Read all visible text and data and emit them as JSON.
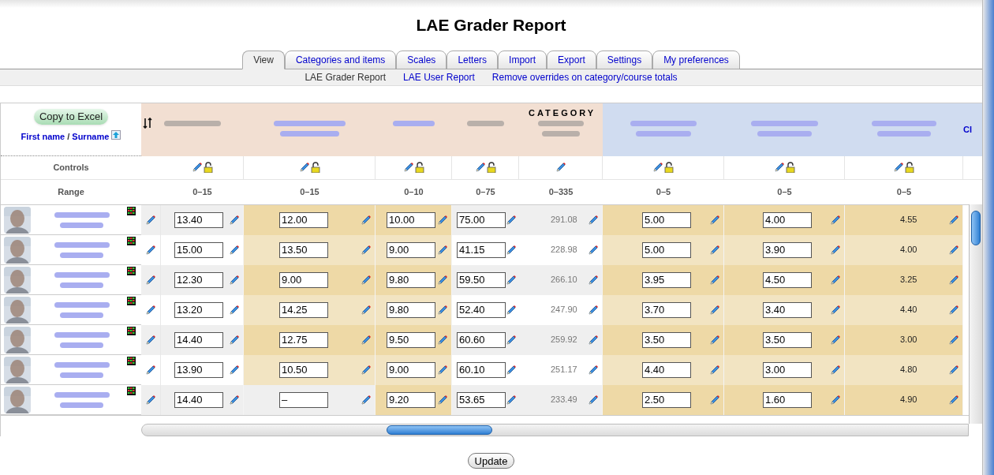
{
  "title": "LAE Grader Report",
  "tabs": [
    {
      "label": "View",
      "selected": true
    },
    {
      "label": "Categories and items",
      "selected": false
    },
    {
      "label": "Scales",
      "selected": false
    },
    {
      "label": "Letters",
      "selected": false
    },
    {
      "label": "Import",
      "selected": false
    },
    {
      "label": "Export",
      "selected": false
    },
    {
      "label": "Settings",
      "selected": false
    },
    {
      "label": "My preferences",
      "selected": false
    }
  ],
  "subnav": [
    {
      "label": "LAE Grader Report",
      "selected": true
    },
    {
      "label": "LAE User Report",
      "selected": false
    },
    {
      "label": "Remove overrides on category/course totals",
      "selected": false
    }
  ],
  "grader": {
    "copy_button": "Copy to Excel",
    "sort_links": [
      "First name",
      "Surname"
    ],
    "sort_separator": "/",
    "controls_label": "Controls",
    "range_label": "Range",
    "partial_header": "Cl",
    "columns": [
      {
        "link": false,
        "color": "#f2dfd2",
        "kind": "input",
        "lock": true,
        "range": "0–15"
      },
      {
        "link": true,
        "color": "#f2dfd2",
        "kind": "input",
        "lock": true,
        "range": "0–15"
      },
      {
        "link": true,
        "color": "#f2dfd2",
        "kind": "input",
        "lock": true,
        "range": "0–10"
      },
      {
        "link": false,
        "color": "#f2dfd2",
        "kind": "input",
        "lock": true,
        "range": "0–75"
      },
      {
        "link": false,
        "color": "#f2dfd2",
        "kind": "total",
        "lock": false,
        "range": "0–335",
        "category_label": "CATEGORY"
      },
      {
        "link": true,
        "color": "#d0dcf0",
        "kind": "input",
        "lock": true,
        "range": "0–5"
      },
      {
        "link": true,
        "color": "#d0dcf0",
        "kind": "input",
        "lock": true,
        "range": "0–5"
      },
      {
        "link": true,
        "color": "#d0dcf0",
        "kind": "total",
        "lock": true,
        "range": "0–5"
      }
    ],
    "rows": [
      {
        "cells": [
          {
            "value": "13.40",
            "highlighted": false
          },
          {
            "value": "12.00",
            "highlighted": true
          },
          {
            "value": "10.00",
            "highlighted": true
          },
          {
            "value": "75.00",
            "highlighted": false
          },
          {
            "value": "291.08",
            "highlighted": false
          },
          {
            "value": "5.00",
            "highlighted": true
          },
          {
            "value": "4.00",
            "highlighted": true
          },
          {
            "value": "4.55",
            "highlighted": true
          }
        ]
      },
      {
        "cells": [
          {
            "value": "15.00",
            "highlighted": false
          },
          {
            "value": "13.50",
            "highlighted": true
          },
          {
            "value": "9.00",
            "highlighted": true
          },
          {
            "value": "41.15",
            "highlighted": false
          },
          {
            "value": "228.98",
            "highlighted": false
          },
          {
            "value": "5.00",
            "highlighted": true
          },
          {
            "value": "3.90",
            "highlighted": true
          },
          {
            "value": "4.00",
            "highlighted": true
          }
        ]
      },
      {
        "cells": [
          {
            "value": "12.30",
            "highlighted": false
          },
          {
            "value": "9.00",
            "highlighted": true
          },
          {
            "value": "9.80",
            "highlighted": true
          },
          {
            "value": "59.50",
            "highlighted": false
          },
          {
            "value": "266.10",
            "highlighted": false
          },
          {
            "value": "3.95",
            "highlighted": true
          },
          {
            "value": "4.50",
            "highlighted": true
          },
          {
            "value": "3.25",
            "highlighted": true
          }
        ]
      },
      {
        "cells": [
          {
            "value": "13.20",
            "highlighted": false
          },
          {
            "value": "14.25",
            "highlighted": true
          },
          {
            "value": "9.80",
            "highlighted": true
          },
          {
            "value": "52.40",
            "highlighted": false
          },
          {
            "value": "247.90",
            "highlighted": false
          },
          {
            "value": "3.70",
            "highlighted": true
          },
          {
            "value": "3.40",
            "highlighted": true
          },
          {
            "value": "4.40",
            "highlighted": true
          }
        ]
      },
      {
        "cells": [
          {
            "value": "14.40",
            "highlighted": false
          },
          {
            "value": "12.75",
            "highlighted": true
          },
          {
            "value": "9.50",
            "highlighted": true
          },
          {
            "value": "60.60",
            "highlighted": false
          },
          {
            "value": "259.92",
            "highlighted": false
          },
          {
            "value": "3.50",
            "highlighted": true
          },
          {
            "value": "3.50",
            "highlighted": true
          },
          {
            "value": "3.00",
            "highlighted": true
          }
        ]
      },
      {
        "cells": [
          {
            "value": "13.90",
            "highlighted": false
          },
          {
            "value": "10.50",
            "highlighted": true
          },
          {
            "value": "9.00",
            "highlighted": true
          },
          {
            "value": "60.10",
            "highlighted": false
          },
          {
            "value": "251.17",
            "highlighted": false
          },
          {
            "value": "4.40",
            "highlighted": true
          },
          {
            "value": "3.00",
            "highlighted": true
          },
          {
            "value": "4.80",
            "highlighted": true
          }
        ]
      },
      {
        "cells": [
          {
            "value": "14.40",
            "highlighted": false
          },
          {
            "value": "–",
            "highlighted": false
          },
          {
            "value": "9.20",
            "highlighted": true
          },
          {
            "value": "53.65",
            "highlighted": false
          },
          {
            "value": "233.49",
            "highlighted": false
          },
          {
            "value": "2.50",
            "highlighted": true
          },
          {
            "value": "1.60",
            "highlighted": true
          },
          {
            "value": "4.90",
            "highlighted": true
          }
        ]
      }
    ]
  },
  "update_button": "Update"
}
